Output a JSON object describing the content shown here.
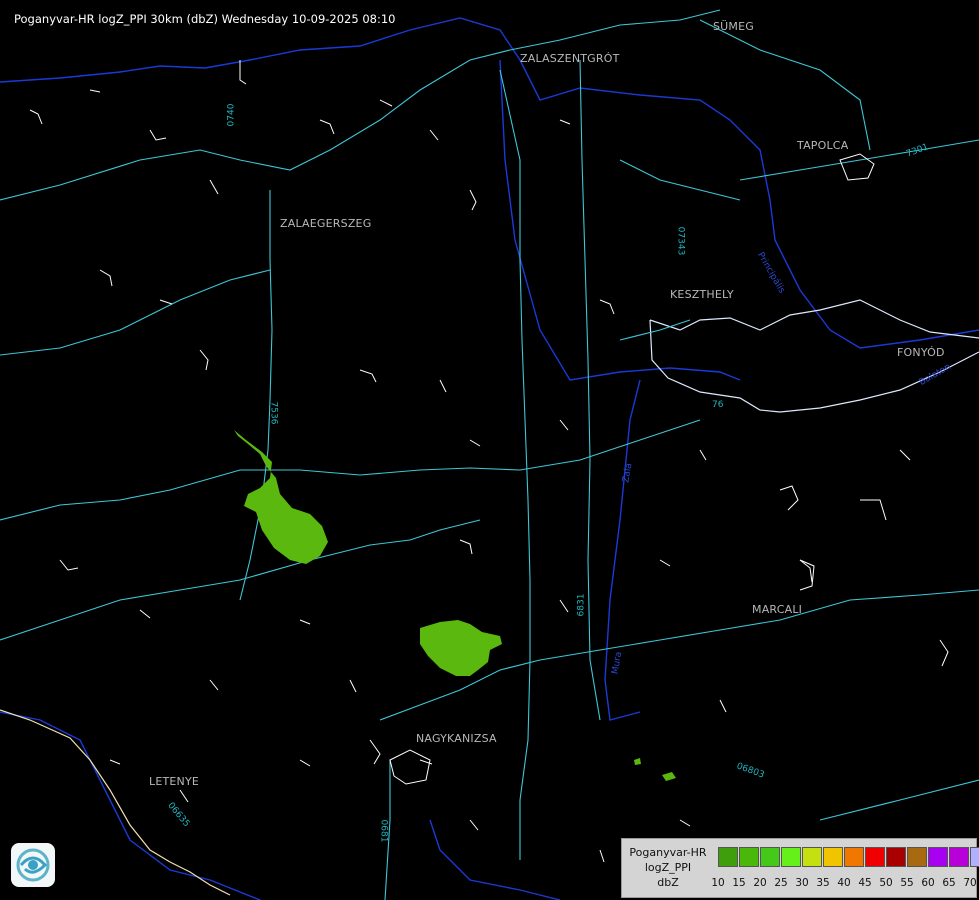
{
  "header": {
    "title": "Poganyvar-HR logZ_PPI 30km (dbZ) Wednesday 10-09-2025 08:10"
  },
  "cities": [
    "SÜMEG",
    "ZALASZENTGRÓT",
    "TAPOLCA",
    "ZALAEGERSZEG",
    "KESZTHELY",
    "FONYÓD",
    "MARCALI",
    "NAGYKANIZSA",
    "LETENYE"
  ],
  "road_labels": [
    "0740",
    "07343",
    "76",
    "7536",
    "06803",
    "0681",
    "06635",
    "7301",
    "6831"
  ],
  "water_labels": [
    "Zala",
    "Balaton",
    "Principális",
    "Mura"
  ],
  "legend": {
    "line1": "Poganyvar-HR",
    "line2": "logZ_PPI",
    "line3": "dbZ",
    "ticks": [
      "10",
      "15",
      "20",
      "25",
      "30",
      "35",
      "40",
      "45",
      "50",
      "55",
      "60",
      "65",
      "70"
    ],
    "colors": [
      "#3e9e0c",
      "#4ab80a",
      "#44c81a",
      "#66f01a",
      "#c4e010",
      "#f0c400",
      "#f07800",
      "#f00000",
      "#a80000",
      "#a86a10",
      "#a800f0",
      "#b800d8",
      "#b0b0ff"
    ]
  },
  "colors": {
    "background": "#000000",
    "roads": "#3ec6d6",
    "minor_roads": "#ffffff",
    "rivers": "#1a3ad6",
    "echo": "#5ab80e"
  },
  "icons": [
    "logo-icon"
  ]
}
